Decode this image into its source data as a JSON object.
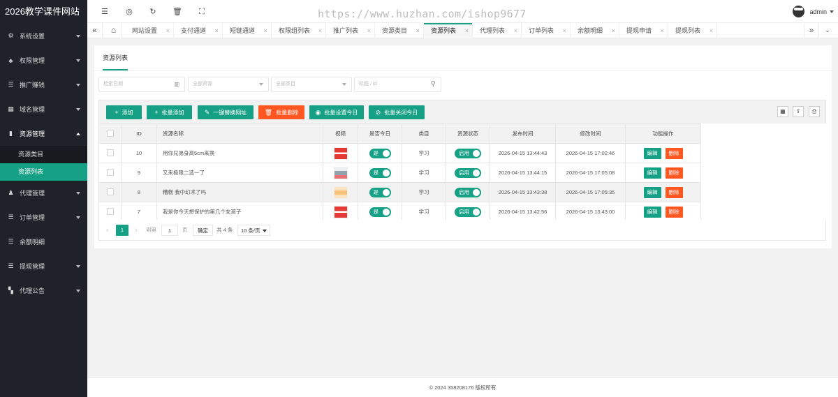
{
  "app": {
    "title": "2026教学课件网站"
  },
  "sidebar": {
    "items": [
      {
        "label": "系统设置",
        "icon": "gear-icon",
        "has_caret": true
      },
      {
        "label": "权限管理",
        "icon": "users-icon",
        "has_caret": true
      },
      {
        "label": "推广赚钱",
        "icon": "list-icon",
        "has_caret": true
      },
      {
        "label": "域名管理",
        "icon": "grid-icon",
        "has_caret": true
      },
      {
        "label": "资源管理",
        "icon": "file-icon",
        "has_caret": true,
        "open": true,
        "children": [
          {
            "label": "资源类目"
          },
          {
            "label": "资源列表",
            "active": true
          }
        ]
      },
      {
        "label": "代理管理",
        "icon": "user-group-icon",
        "has_caret": true
      },
      {
        "label": "订单管理",
        "icon": "list-icon",
        "has_caret": true
      },
      {
        "label": "余额明细",
        "icon": "list-icon",
        "has_caret": false
      },
      {
        "label": "提现管理",
        "icon": "list-icon",
        "has_caret": true
      },
      {
        "label": "代理公告",
        "icon": "apps-icon",
        "has_caret": true
      }
    ]
  },
  "header": {
    "watermark": "https://www.huzhan.com/ishop9677",
    "username": "admin"
  },
  "tabs": [
    {
      "label": "网站设置"
    },
    {
      "label": "支付通道"
    },
    {
      "label": "短链通道"
    },
    {
      "label": "权限组列表"
    },
    {
      "label": "推广列表"
    },
    {
      "label": "资源类目"
    },
    {
      "label": "资源列表",
      "active": true
    },
    {
      "label": "代理列表"
    },
    {
      "label": "订单列表"
    },
    {
      "label": "余额明细"
    },
    {
      "label": "提现申请"
    },
    {
      "label": "提现列表"
    }
  ],
  "main": {
    "subtab": "资源列表",
    "filters": {
      "date_placeholder": "检索日期",
      "resource_placeholder": "全部资源",
      "category_placeholder": "全部类目",
      "title_placeholder": "标题 / id"
    },
    "toolbar": {
      "add": "添加",
      "batch_add": "批量添加",
      "replace_url": "一键替换网址",
      "batch_delete": "批量删除",
      "batch_set_today": "批量设置今日",
      "batch_close_today": "批量关闭今日"
    },
    "table": {
      "headers": {
        "id": "ID",
        "name": "资源名称",
        "video": "视频",
        "today": "是否今日",
        "category": "类目",
        "status": "资源状态",
        "publish": "发布时间",
        "modify": "修改时间",
        "ops": "功能操作"
      },
      "rows": [
        {
          "id": "10",
          "name": "用你兄弟身高5cm来换",
          "today": "是",
          "category": "学习",
          "status": "启用",
          "publish": "2026-04-15 13:44:43",
          "modify": "2026-04-15 17:02:46",
          "thumb_color": "#e53935"
        },
        {
          "id": "9",
          "name": "又来极限二选一了",
          "today": "是",
          "category": "学习",
          "status": "启用",
          "publish": "2026-04-15 13:44:15",
          "modify": "2026-04-15 17:05:08",
          "thumb_color": "#90a4ae"
        },
        {
          "id": "8",
          "name": "糟糕 我中幻术了吗",
          "today": "是",
          "category": "学习",
          "status": "启用",
          "publish": "2026-04-15 13:43:38",
          "modify": "2026-04-15 17:05:35",
          "thumb_color": "#f5c27a"
        },
        {
          "id": "7",
          "name": "我是你今天想保护的第几个女孩子",
          "today": "是",
          "category": "学习",
          "status": "启用",
          "publish": "2026-04-15 13:42:56",
          "modify": "2026-04-15 13:43:00",
          "thumb_color": "#e53935"
        }
      ],
      "edit_label": "编辑",
      "delete_label": "删除"
    },
    "pagination": {
      "current": "1",
      "goto_label": "到第",
      "page_input": "1",
      "page_label": "页",
      "confirm": "确定",
      "total": "共 4 条",
      "page_size": "10 条/页"
    }
  },
  "footer": {
    "copyright": "© 2024 358208176 版权所有"
  },
  "colors": {
    "accent": "#16a085",
    "danger": "#ff5722",
    "sidebar": "#20222a"
  }
}
